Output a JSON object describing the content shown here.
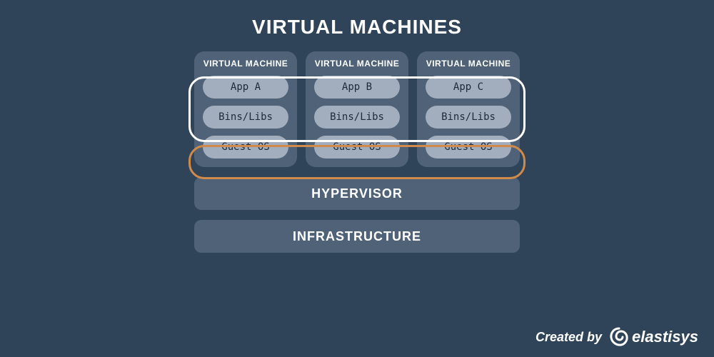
{
  "title": "VIRTUAL MACHINES",
  "vms": [
    {
      "header": "VIRTUAL MACHINE",
      "app": "App A",
      "libs": "Bins/Libs",
      "os": "Guest OS"
    },
    {
      "header": "VIRTUAL MACHINE",
      "app": "App B",
      "libs": "Bins/Libs",
      "os": "Guest OS"
    },
    {
      "header": "VIRTUAL MACHINE",
      "app": "App C",
      "libs": "Bins/Libs",
      "os": "Guest OS"
    }
  ],
  "layers": {
    "hypervisor": "HYPERVISOR",
    "infrastructure": "INFRASTRUCTURE"
  },
  "footer": {
    "created_by": "Created by",
    "brand": "elastisys"
  },
  "colors": {
    "bg": "#2f4459",
    "block": "#4f6277",
    "pill": "#a2adbd",
    "highlight_white": "#ffffff",
    "highlight_orange": "#d08a49"
  }
}
